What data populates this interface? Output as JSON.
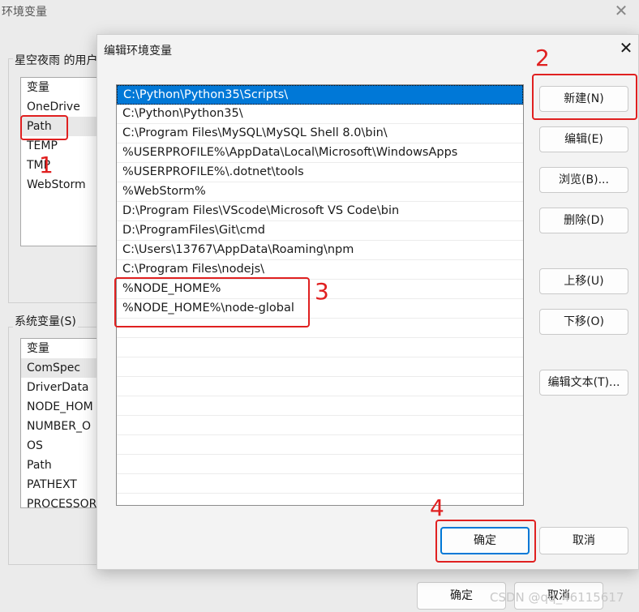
{
  "background_dialog": {
    "title": "环境变量",
    "close_icon": "close-icon",
    "user_section_label": "星空夜雨 的用户",
    "user_list_header": "变量",
    "user_vars": [
      "OneDrive",
      "Path",
      "TEMP",
      "TMP",
      "WebStorm"
    ],
    "user_selected": "Path",
    "system_section_label": "系统变量(S)",
    "system_list_header": "变量",
    "system_vars": [
      "ComSpec",
      "DriverData",
      "NODE_HOM",
      "NUMBER_O",
      "OS",
      "Path",
      "PATHEXT",
      "PROCESSOR"
    ],
    "system_selected": "ComSpec",
    "ok_label": "确定",
    "cancel_label": "取消"
  },
  "modal": {
    "title": "编辑环境变量",
    "close_icon": "close-icon",
    "path_entries": [
      "C:\\Python\\Python35\\Scripts\\",
      "C:\\Python\\Python35\\",
      "C:\\Program Files\\MySQL\\MySQL Shell 8.0\\bin\\",
      "%USERPROFILE%\\AppData\\Local\\Microsoft\\WindowsApps",
      "%USERPROFILE%\\.dotnet\\tools",
      "%WebStorm%",
      "D:\\Program Files\\VScode\\Microsoft VS Code\\bin",
      "D:\\ProgramFiles\\Git\\cmd",
      "C:\\Users\\13767\\AppData\\Roaming\\npm",
      "C:\\Program Files\\nodejs\\",
      "%NODE_HOME%",
      "%NODE_HOME%\\node-global"
    ],
    "selected_index": 0,
    "buttons": {
      "new": "新建(N)",
      "edit": "编辑(E)",
      "browse": "浏览(B)...",
      "delete": "删除(D)",
      "move_up": "上移(U)",
      "move_down": "下移(O)",
      "edit_text": "编辑文本(T)...",
      "ok": "确定",
      "cancel": "取消"
    }
  },
  "annotations": {
    "step1": "1",
    "step2": "2",
    "step3": "3",
    "step4": "4",
    "color": "#e02020"
  },
  "watermark": "CSDN @qq_46115617",
  "colors": {
    "selection": "#0078d7",
    "accent_red": "#e02020"
  }
}
